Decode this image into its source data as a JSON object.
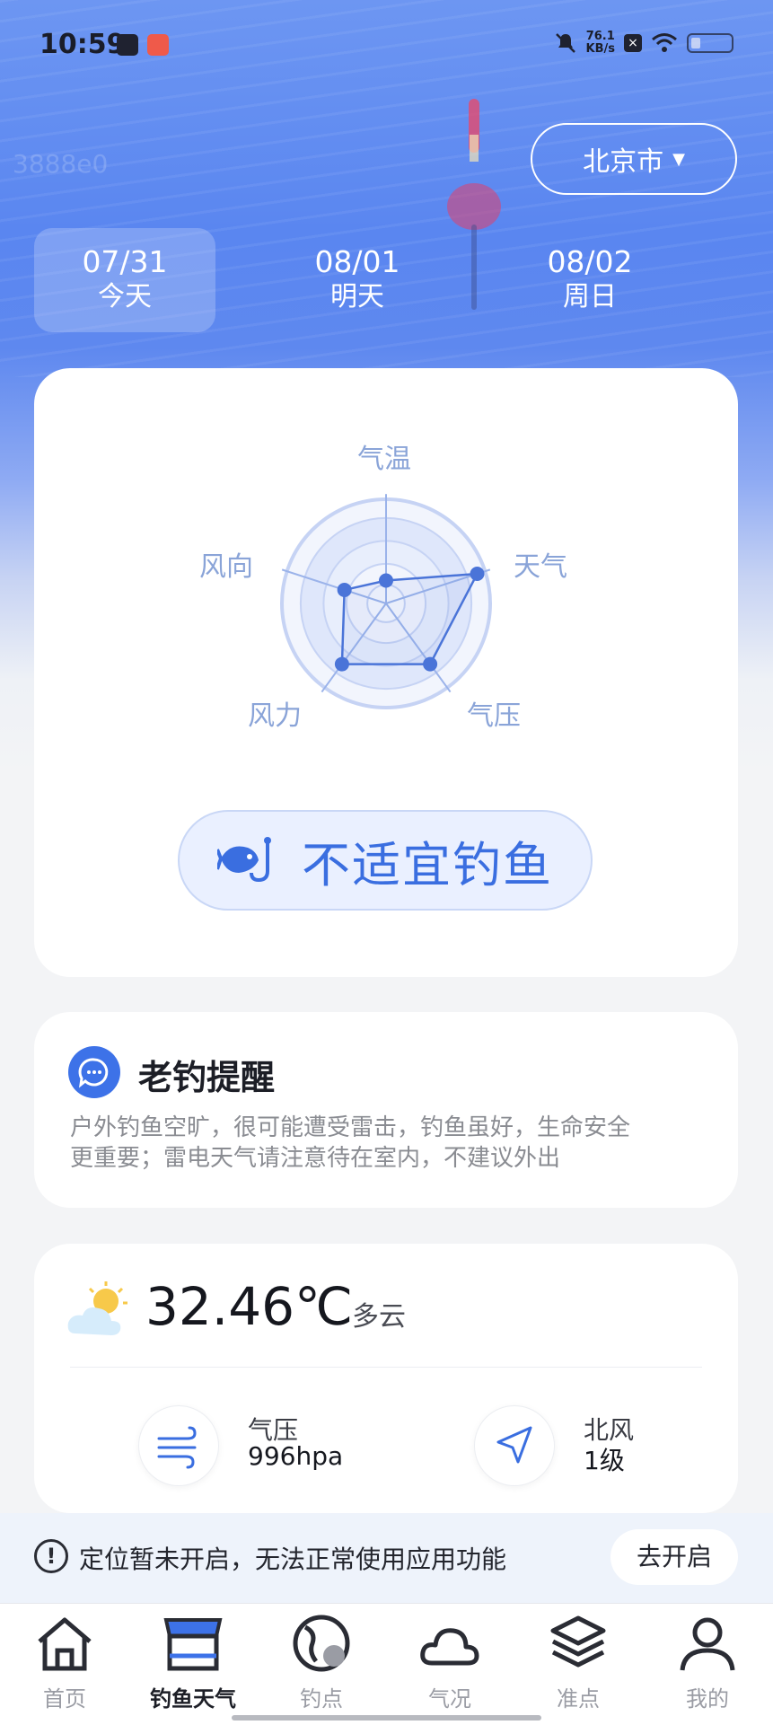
{
  "status_bar": {
    "time": "10:59",
    "net_speed_value": "76.1",
    "net_speed_unit": "KB/s"
  },
  "watermark": "3888e0",
  "location": {
    "city": "北京市"
  },
  "dates": [
    {
      "date": "07/31",
      "label": "今天",
      "active": true
    },
    {
      "date": "08/01",
      "label": "明天",
      "active": false
    },
    {
      "date": "08/02",
      "label": "周日",
      "active": false
    }
  ],
  "radar": {
    "axes": [
      "气温",
      "天气",
      "气压",
      "风力",
      "风向"
    ],
    "values": [
      0.22,
      0.92,
      0.72,
      0.72,
      0.42
    ],
    "color": "#4a74d8"
  },
  "verdict": {
    "text": "不适宜钓鱼",
    "icon": "fish-hook-icon"
  },
  "reminder": {
    "title": "老钓提醒",
    "lines": [
      "户外钓鱼空旷，很可能遭受雷击，钓鱼虽好，生命安全",
      "更重要；雷电天气请注意待在室内，不建议外出"
    ]
  },
  "weather": {
    "temperature": "32.46℃",
    "condition": "多云",
    "pressure_label": "气压",
    "pressure_value": "996hpa",
    "wind_label": "北风",
    "wind_value": "1级"
  },
  "location_notice": {
    "text": "定位暂未开启，无法正常使用应用功能",
    "button": "去开启"
  },
  "tabs": [
    {
      "label": "首页",
      "icon": "home-icon",
      "active": false
    },
    {
      "label": "钓鱼天气",
      "icon": "fishing-weather-icon",
      "active": true
    },
    {
      "label": "钓点",
      "icon": "map-globe-icon",
      "active": false
    },
    {
      "label": "气况",
      "icon": "cloud-icon",
      "active": false
    },
    {
      "label": "准点",
      "icon": "layers-icon",
      "active": false
    },
    {
      "label": "我的",
      "icon": "user-icon",
      "active": false
    }
  ],
  "colors": {
    "accent": "#3d72e8",
    "sky": "#5a86f0"
  }
}
